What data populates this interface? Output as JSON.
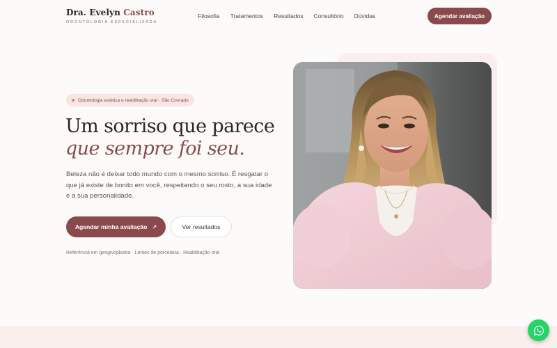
{
  "header": {
    "brand_first": "Dra. Evelyn",
    "brand_last": "Castro",
    "brand_subtitle": "ODONTOLOGIA ESPECIALIZADA",
    "nav": [
      "Filosofia",
      "Tratamentos",
      "Resultados",
      "Consultório",
      "Dúvidas"
    ],
    "cta_label": "Agendar avaliação"
  },
  "hero": {
    "pill_text": "Odontologia estética e reabilitação oral · São Conrado",
    "title_line1": "Um sorriso que parece",
    "title_line2": "que sempre foi seu.",
    "lead": "Beleza não é deixar todo mundo com o mesmo sorriso. É resgatar o que já existe de bonito em você, respeitando o seu rosto, a sua idade e a sua personalidade.",
    "primary_button": "Agendar minha avaliação",
    "primary_button_icon": "arrow-up-right-icon",
    "secondary_button": "Ver resultados",
    "references": "Referência em gengivoplastia · Lentes de porcelana · Reabilitação oral"
  },
  "floating": {
    "whatsapp_icon": "whatsapp-icon"
  },
  "colors": {
    "accent": "#8a4a4b",
    "accent_soft": "#f7e6e5",
    "background": "#fdfbfa",
    "whatsapp": "#25d366"
  }
}
